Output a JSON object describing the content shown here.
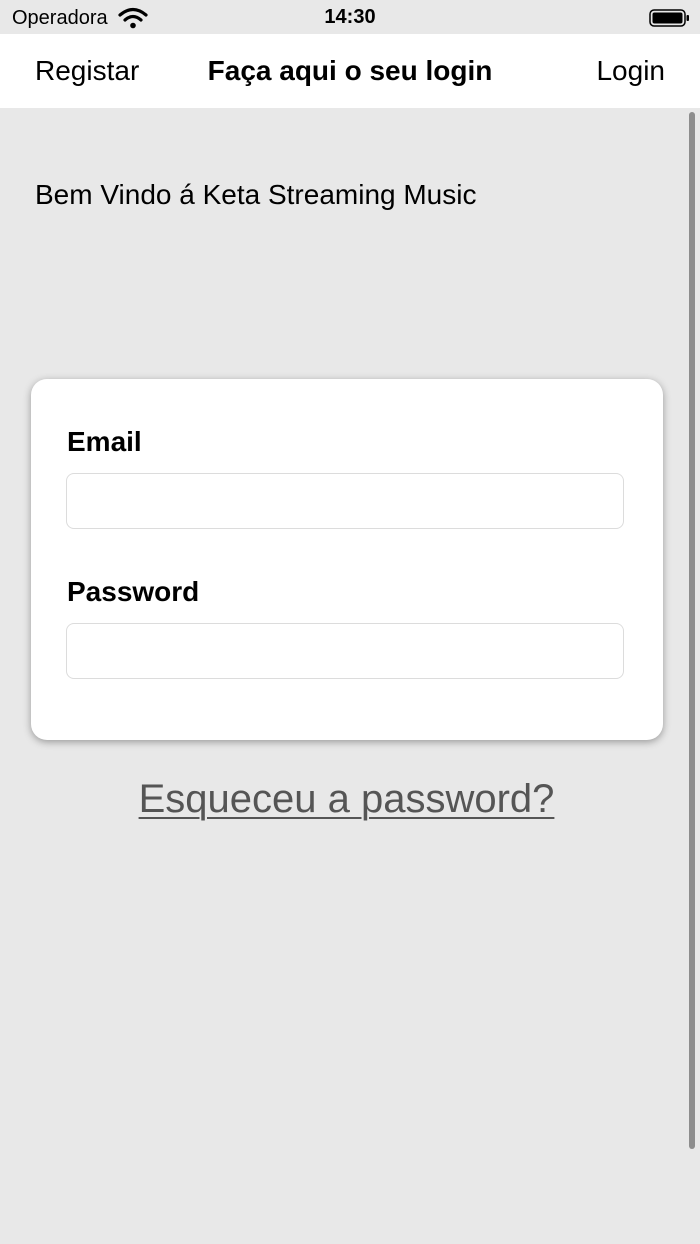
{
  "status_bar": {
    "carrier": "Operadora",
    "time": "14:30",
    "wifi_icon": "wifi-icon",
    "battery_icon": "battery-full-icon"
  },
  "nav": {
    "left_label": "Registar",
    "title": "Faça aqui o seu login",
    "right_label": "Login"
  },
  "welcome_text": "Bem Vindo á Keta Streaming Music",
  "form": {
    "email_label": "Email",
    "email_value": "",
    "email_placeholder": "",
    "password_label": "Password",
    "password_value": "",
    "password_placeholder": ""
  },
  "forgot_password_label": "Esqueceu a password?",
  "colors": {
    "background": "#e8e8e8",
    "nav_background": "#ffffff",
    "card_background": "#ffffff",
    "link_color": "#555555",
    "scrollbar": "#8d8d8d"
  }
}
